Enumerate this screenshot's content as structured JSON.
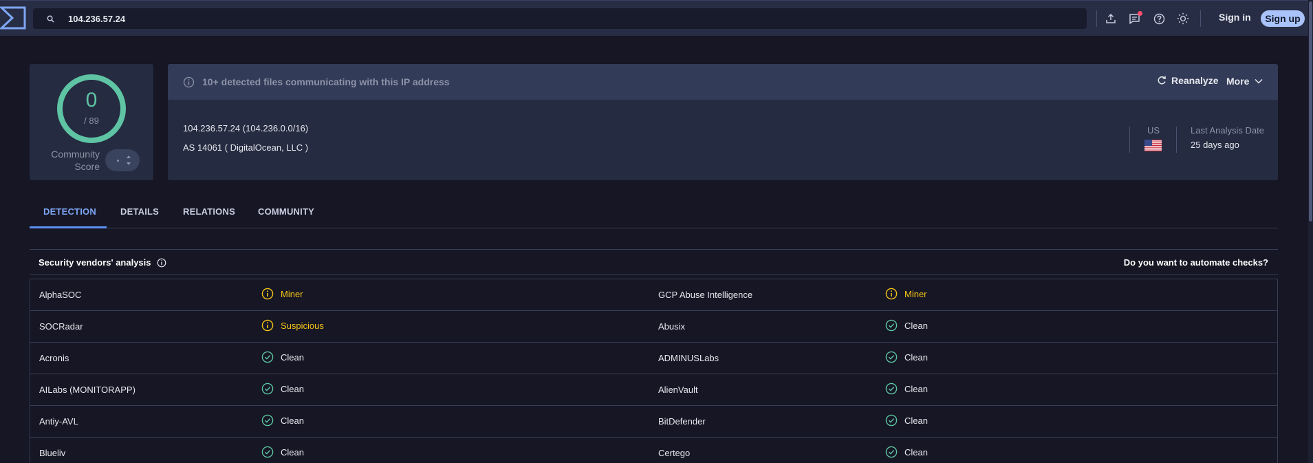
{
  "topbar": {
    "search_value": "104.236.57.24",
    "sign_in_label": "Sign in",
    "sign_up_label": "Sign up"
  },
  "score": {
    "detections": "0",
    "total": "/ 89",
    "community_label_line1": "Community",
    "community_label_line2": "Score"
  },
  "banner": {
    "text": "10+ detected files communicating with this IP address",
    "reanalyze_label": "Reanalyze",
    "more_label": "More"
  },
  "ip_info": {
    "ip_line": "104.236.57.24  (104.236.0.0/16)",
    "as_line": "AS 14061  ( DigitalOcean, LLC )",
    "country": "US",
    "last_analysis_label": "Last Analysis Date",
    "last_analysis_value": "25 days ago"
  },
  "tabs": [
    {
      "label": "DETECTION"
    },
    {
      "label": "DETAILS"
    },
    {
      "label": "RELATIONS"
    },
    {
      "label": "COMMUNITY"
    }
  ],
  "vendors": {
    "title": "Security vendors' analysis",
    "automate_label": "Do you want to automate checks?",
    "rows": [
      {
        "left": {
          "name": "AlphaSOC",
          "status": "Miner"
        },
        "right": {
          "name": "GCP Abuse Intelligence",
          "status": "Miner"
        }
      },
      {
        "left": {
          "name": "SOCRadar",
          "status": "Suspicious"
        },
        "right": {
          "name": "Abusix",
          "status": "Clean"
        }
      },
      {
        "left": {
          "name": "Acronis",
          "status": "Clean"
        },
        "right": {
          "name": "ADMINUSLabs",
          "status": "Clean"
        }
      },
      {
        "left": {
          "name": "AILabs (MONITORAPP)",
          "status": "Clean"
        },
        "right": {
          "name": "AlienVault",
          "status": "Clean"
        }
      },
      {
        "left": {
          "name": "Antiy-AVL",
          "status": "Clean"
        },
        "right": {
          "name": "BitDefender",
          "status": "Clean"
        }
      },
      {
        "left": {
          "name": "Blueliv",
          "status": "Clean"
        },
        "right": {
          "name": "Certego",
          "status": "Clean"
        }
      }
    ]
  },
  "colors": {
    "accent": "#7ea7f4",
    "clean": "#5ec4a3",
    "warning": "#f5c518",
    "background": "#161624",
    "card": "#252b40"
  },
  "icons": {
    "logo": "virustotal-logo",
    "search": "search-icon",
    "upload": "upload-icon",
    "chat": "chat-icon",
    "help": "help-icon",
    "theme": "sun-icon",
    "info": "info-icon",
    "reanalyze": "refresh-icon",
    "more": "chevron-down-icon",
    "clean": "check-circle-icon",
    "warn": "alert-circle-icon",
    "flag": "us-flag-icon"
  }
}
